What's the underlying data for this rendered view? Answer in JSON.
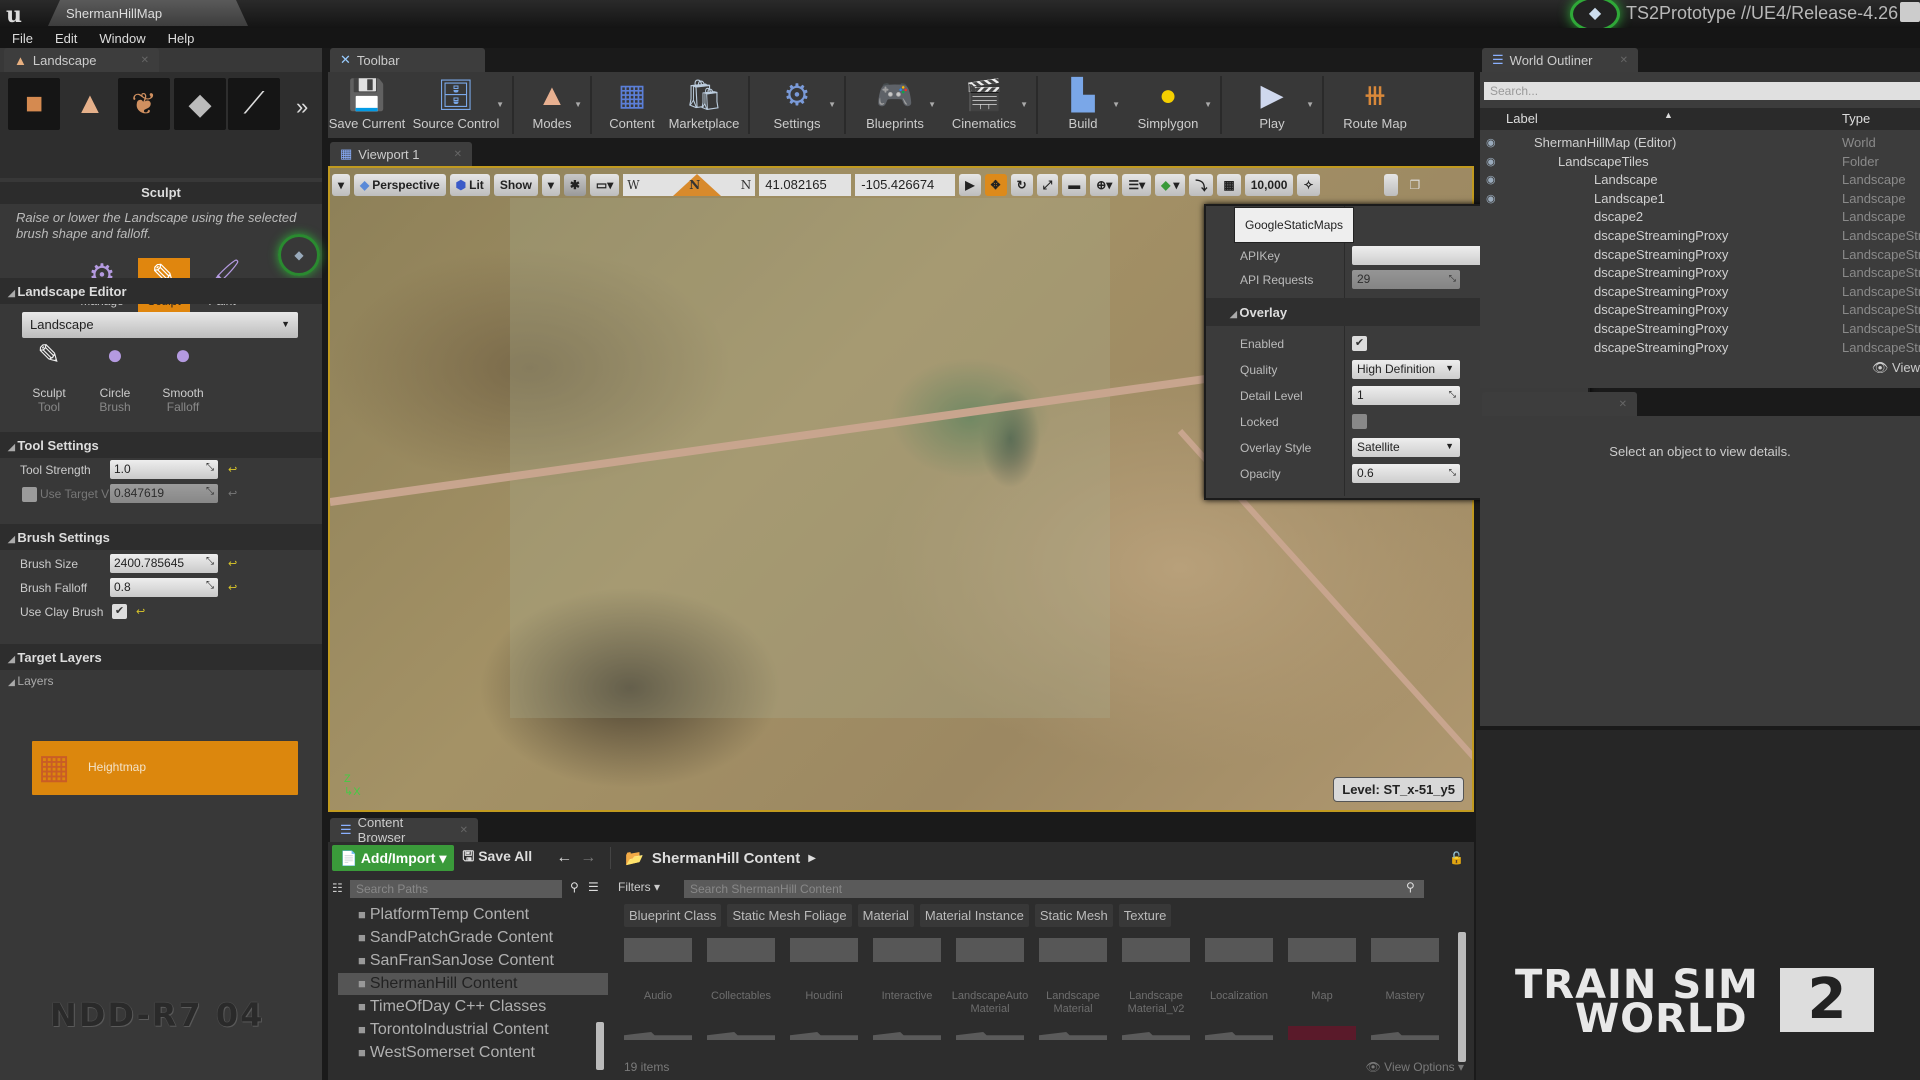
{
  "titlebar": {
    "tab": "ShermanHillMap",
    "project": "TS2Prototype //UE4/Release-4.26"
  },
  "menu": [
    "File",
    "Edit",
    "Window",
    "Help"
  ],
  "landscape_panel": {
    "tab": "Landscape",
    "mode_icons": [
      "place-mode-icon",
      "landscape-mode-icon",
      "foliage-mode-icon",
      "mesh-paint-mode-icon",
      "paint-brush-mode-icon"
    ],
    "more": "»",
    "section": "Sculpt",
    "description": "Raise or lower the Landscape using the selected brush shape and falloff.",
    "tool_modes": [
      {
        "label": "Manage",
        "active": false
      },
      {
        "label": "Sculpt",
        "active": true
      },
      {
        "label": "Paint",
        "active": false
      }
    ],
    "editor_header": "Landscape Editor",
    "landscape_select": "Landscape",
    "tools": [
      {
        "label": "Sculpt",
        "sub": "Tool"
      },
      {
        "label": "Circle",
        "sub": "Brush"
      },
      {
        "label": "Smooth",
        "sub": "Falloff"
      }
    ],
    "tool_settings": {
      "header": "Tool Settings",
      "tool_strength_label": "Tool Strength",
      "tool_strength": "1.0",
      "use_target_label": "Use Target V",
      "use_target_value": "0.847619",
      "use_target_checked": false
    },
    "brush_settings": {
      "header": "Brush Settings",
      "brush_size_label": "Brush Size",
      "brush_size": "2400.785645",
      "brush_falloff_label": "Brush Falloff",
      "brush_falloff": "0.8",
      "clay_label": "Use Clay Brush",
      "clay_checked": true
    },
    "target_layers": {
      "header": "Target Layers",
      "layers_label": "Layers",
      "heightmap": "Heightmap"
    },
    "watermark": "NDD-R7 04"
  },
  "toolbar": {
    "tab": "Toolbar",
    "buttons": [
      {
        "label": "Save Current",
        "icon": "save-icon"
      },
      {
        "label": "Source Control",
        "icon": "source-control-icon"
      },
      {
        "label": "Modes",
        "icon": "modes-icon"
      },
      {
        "label": "Content",
        "icon": "content-icon"
      },
      {
        "label": "Marketplace",
        "icon": "marketplace-icon"
      },
      {
        "label": "Settings",
        "icon": "settings-icon"
      },
      {
        "label": "Blueprints",
        "icon": "blueprints-icon"
      },
      {
        "label": "Cinematics",
        "icon": "cinematics-icon"
      },
      {
        "label": "Build",
        "icon": "build-icon"
      },
      {
        "label": "Simplygon",
        "icon": "simplygon-icon"
      },
      {
        "label": "Play",
        "icon": "play-icon"
      },
      {
        "label": "Route Map",
        "icon": "route-map-icon"
      }
    ]
  },
  "viewport": {
    "tab": "Viewport 1",
    "perspective": "Perspective",
    "lit": "Lit",
    "show": "Show",
    "compass_w": "W",
    "compass_n": "N",
    "lat": "41.082165",
    "lon": "-105.426674",
    "grid_value": "10,000",
    "level": "Level:  ST_x-51_y5"
  },
  "gsm": {
    "title": "GoogleStaticMaps",
    "apikey_label": "APIKey",
    "apikey": "",
    "api_requests_label": "API Requests",
    "api_requests": "29",
    "overlay_header": "Overlay",
    "enabled_label": "Enabled",
    "enabled": true,
    "quality_label": "Quality",
    "quality": "High Definition",
    "detail_label": "Detail Level",
    "detail": "1",
    "locked_label": "Locked",
    "locked": false,
    "style_label": "Overlay Style",
    "style": "Satellite",
    "opacity_label": "Opacity",
    "opacity": "0.6"
  },
  "outliner": {
    "tab": "World Outliner",
    "search_placeholder": "Search...",
    "col_label": "Label",
    "col_type": "Type",
    "rows": [
      {
        "label": "ShermanHillMap (Editor)",
        "type": "World"
      },
      {
        "label": "LandscapeTiles",
        "type": "Folder"
      },
      {
        "label": "Landscape",
        "type": "Landscape"
      },
      {
        "label": "Landscape1",
        "type": "Landscape"
      },
      {
        "label": "dscape2",
        "type": "Landscape"
      },
      {
        "label": "dscapeStreamingProxy",
        "type": "LandscapeStre"
      },
      {
        "label": "dscapeStreamingProxy",
        "type": "LandscapeStre"
      },
      {
        "label": "dscapeStreamingProxy",
        "type": "LandscapeStre"
      },
      {
        "label": "dscapeStreamingProxy",
        "type": "LandscapeStre"
      },
      {
        "label": "dscapeStreamingProxy",
        "type": "LandscapeStre"
      },
      {
        "label": "dscapeStreamingProxy",
        "type": "LandscapeStre"
      },
      {
        "label": "dscapeStreamingProxy",
        "type": "LandscapeStre"
      }
    ],
    "view_options": "View"
  },
  "details": {
    "message": "Select an object to view details."
  },
  "brand": {
    "line1": "TRAIN SIM",
    "line2": "WORLD",
    "num": "2"
  },
  "content_browser": {
    "tab": "Content Browser",
    "add_import": "Add/Import ▾",
    "save_all": "Save All",
    "breadcrumb": "ShermanHill Content",
    "path_search_placeholder": "Search Paths",
    "paths": [
      {
        "label": "PlatformTemp Content",
        "selected": false
      },
      {
        "label": "SandPatchGrade Content",
        "selected": false
      },
      {
        "label": "SanFranSanJose Content",
        "selected": false
      },
      {
        "label": "ShermanHill Content",
        "selected": true
      },
      {
        "label": "TimeOfDay C++ Classes",
        "selected": false
      },
      {
        "label": "TorontoIndustrial Content",
        "selected": false
      },
      {
        "label": "WestSomerset Content",
        "selected": false
      }
    ],
    "filters": "Filters ▾",
    "asset_search_placeholder": "Search ShermanHill Content",
    "chips": [
      "Blueprint Class",
      "Static Mesh Foliage",
      "Material",
      "Material Instance",
      "Static Mesh",
      "Texture"
    ],
    "folders": [
      "Audio",
      "Collectables",
      "Houdini",
      "Interactive",
      "LandscapeAuto Material",
      "Landscape Material",
      "Landscape Material_v2",
      "Localization",
      "Map",
      "Mastery"
    ],
    "item_count": "19 items",
    "view_options": "View Options ▾"
  }
}
